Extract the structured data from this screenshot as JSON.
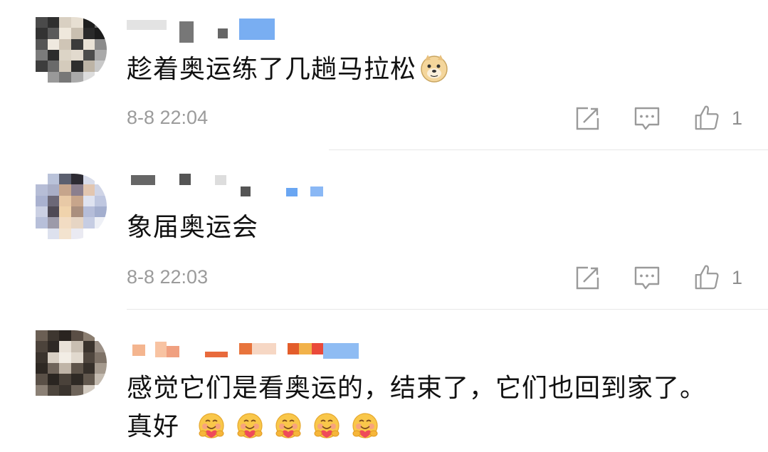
{
  "comments": [
    {
      "text": "趁着奥运练了几趟马拉松",
      "emoji": "doge-emoji",
      "time": "8-8 22:04",
      "like_count": "1"
    },
    {
      "text": "象届奥运会",
      "time": "8-8 22:03",
      "like_count": "1"
    },
    {
      "text_line1": "感觉它们是看奥运的，结束了，它们也回到家了。",
      "text_line2": "真好",
      "emoji": "hug-emoji",
      "emoji_count": 5
    }
  ],
  "icons": {
    "share": "share-icon",
    "reply": "comment-icon",
    "like": "thumbs-up-icon"
  },
  "colors": {
    "timestamp": "#9b9b9b",
    "icon": "#9a9a9a",
    "divider": "#e8e8e8"
  }
}
